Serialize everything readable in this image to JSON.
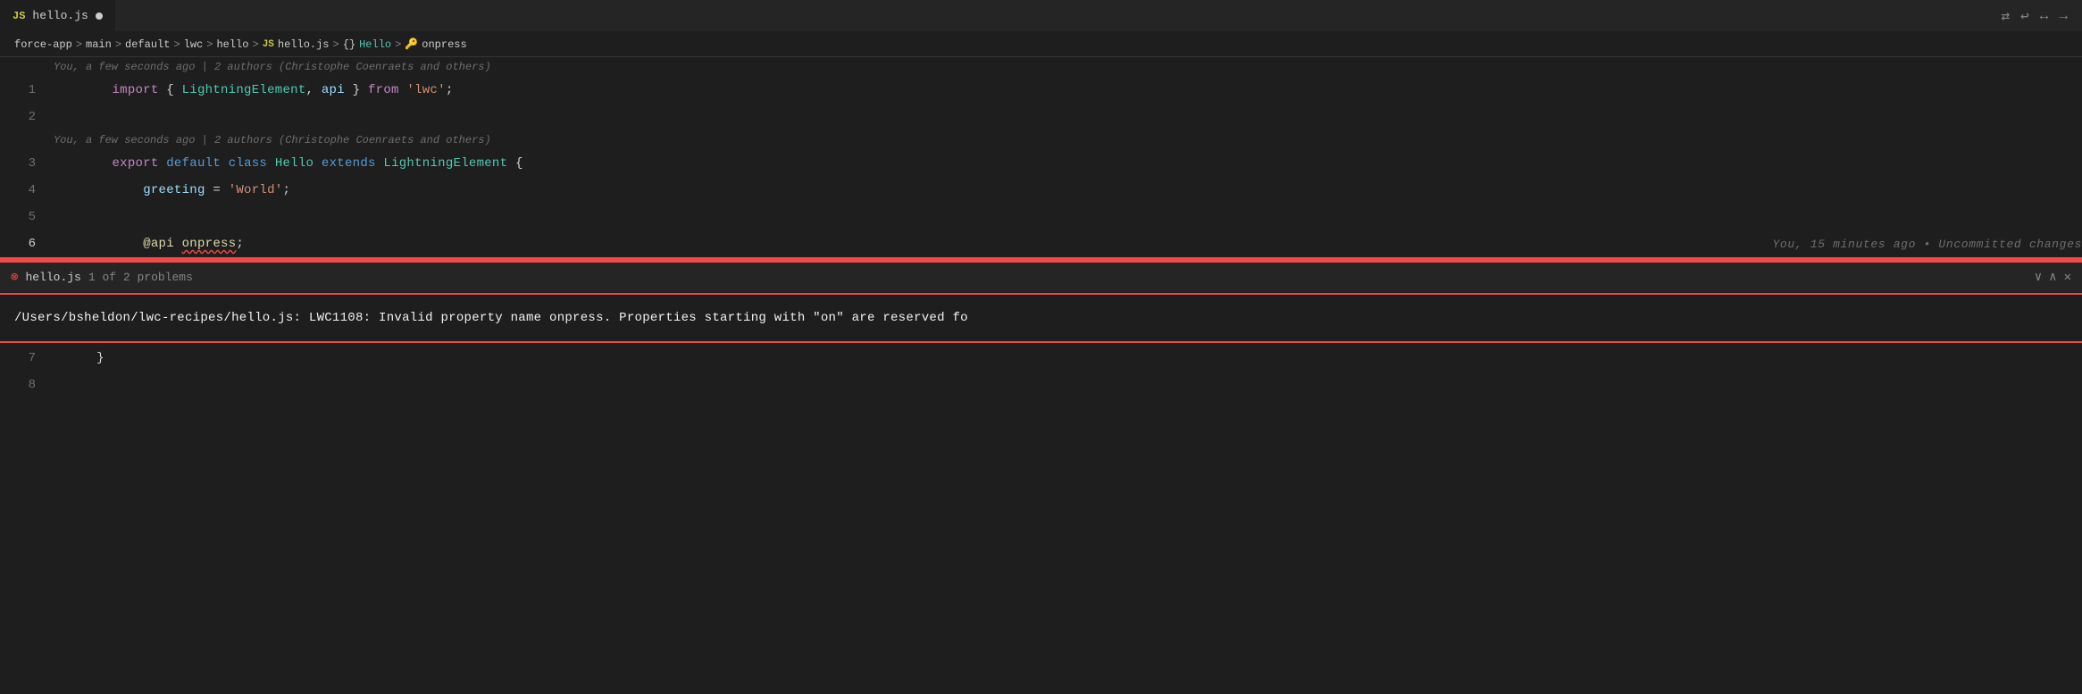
{
  "tab": {
    "icon": "JS",
    "filename": "hello.js",
    "modified": true
  },
  "toolbar": {
    "icons": [
      "⇄",
      "↩",
      "↔",
      "→"
    ]
  },
  "breadcrumb": {
    "items": [
      {
        "text": "force-app",
        "type": "folder"
      },
      {
        "text": "main",
        "type": "folder"
      },
      {
        "text": "default",
        "type": "folder"
      },
      {
        "text": "lwc",
        "type": "folder"
      },
      {
        "text": "hello",
        "type": "folder"
      },
      {
        "text": "hello.js",
        "type": "js-file",
        "icon": "JS"
      },
      {
        "text": "Hello",
        "type": "class",
        "icon": "{}"
      },
      {
        "text": "onpress",
        "type": "property",
        "icon": "🔑"
      }
    ]
  },
  "editor": {
    "git_annotation_1": "You, a few seconds ago | 2 authors (Christophe Coenraets and others)",
    "git_annotation_2": "You, a few seconds ago | 2 authors (Christophe Coenraets and others)",
    "git_blame_line6": "You, 15 minutes ago • Uncommitted changes",
    "lines": [
      {
        "number": "1",
        "tokens": [
          {
            "text": "import",
            "class": "kw-import"
          },
          {
            "text": " { ",
            "class": "punct"
          },
          {
            "text": "LightningElement",
            "class": "cls-name"
          },
          {
            "text": ", ",
            "class": "punct"
          },
          {
            "text": "api",
            "class": "prop-name"
          },
          {
            "text": " } ",
            "class": "punct"
          },
          {
            "text": "from",
            "class": "kw-from"
          },
          {
            "text": " ",
            "class": ""
          },
          {
            "text": "'lwc'",
            "class": "str-val"
          },
          {
            "text": ";",
            "class": "punct"
          }
        ]
      },
      {
        "number": "2",
        "tokens": []
      },
      {
        "number": "3",
        "tokens": [
          {
            "text": "export",
            "class": "kw-export"
          },
          {
            "text": " ",
            "class": ""
          },
          {
            "text": "default",
            "class": "kw-default"
          },
          {
            "text": " ",
            "class": ""
          },
          {
            "text": "class",
            "class": "kw-class"
          },
          {
            "text": " ",
            "class": ""
          },
          {
            "text": "Hello",
            "class": "cls-name"
          },
          {
            "text": " ",
            "class": ""
          },
          {
            "text": "extends",
            "class": "kw-extends"
          },
          {
            "text": " ",
            "class": ""
          },
          {
            "text": "LightningElement",
            "class": "cls-parent"
          },
          {
            "text": " {",
            "class": "punct"
          }
        ]
      },
      {
        "number": "4",
        "tokens": [
          {
            "text": "    greeting",
            "class": "prop-name"
          },
          {
            "text": " = ",
            "class": "punct"
          },
          {
            "text": "'World'",
            "class": "str-val"
          },
          {
            "text": ";",
            "class": "punct"
          }
        ]
      },
      {
        "number": "5",
        "tokens": []
      },
      {
        "number": "6",
        "tokens": [
          {
            "text": "    ",
            "class": ""
          },
          {
            "text": "@api",
            "class": "decorator"
          },
          {
            "text": " ",
            "class": ""
          },
          {
            "text": "onpress",
            "class": "method-name squiggly"
          },
          {
            "text": ";",
            "class": "punct"
          }
        ],
        "blame": "You, 15 minutes ago • Uncommitted changes"
      },
      {
        "number": "7",
        "tokens": [
          {
            "text": "}",
            "class": "punct"
          }
        ]
      },
      {
        "number": "8",
        "tokens": []
      }
    ]
  },
  "error_panel": {
    "filename": "hello.js",
    "count": "1 of 2 problems",
    "message": "/Users/bsheldon/lwc-recipes/hello.js: LWC1108: Invalid property name onpress. Properties starting with \"on\" are reserved fo"
  }
}
